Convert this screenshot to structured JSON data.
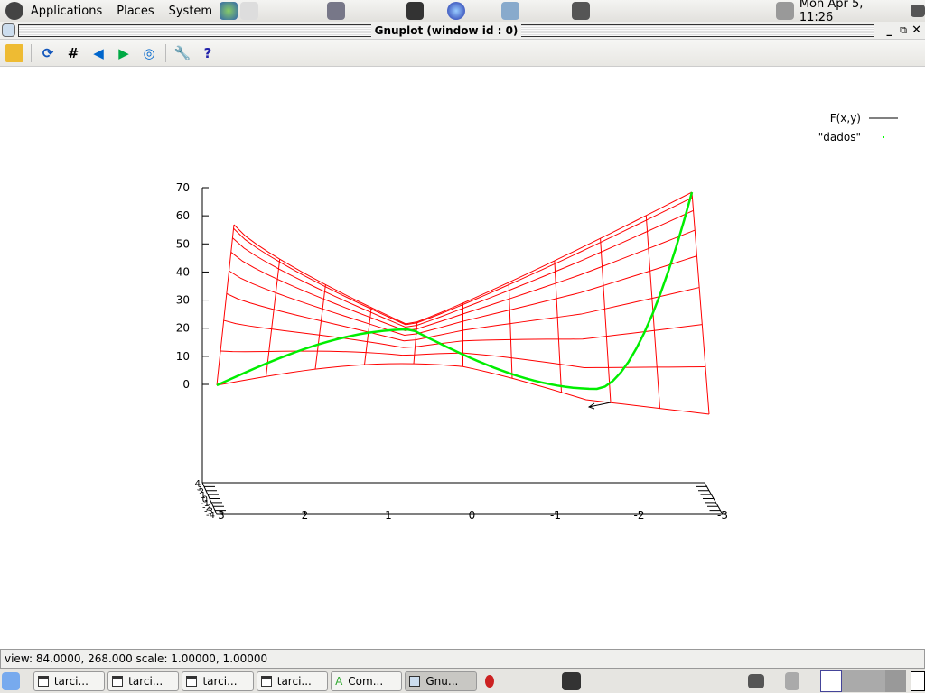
{
  "topbar": {
    "menus": [
      "Applications",
      "Places",
      "System"
    ],
    "clock": "Mon Apr  5, 11:26"
  },
  "window": {
    "title": "Gnuplot (window id : 0)"
  },
  "toolbar": {
    "icons": [
      "copy-clipboard-icon",
      "replot-icon",
      "grid-icon",
      "zoom-prev-icon",
      "zoom-next-icon",
      "autoscale-icon",
      "options-wrench-icon",
      "help-icon"
    ]
  },
  "chart_data": {
    "type": "surface3d",
    "legend": [
      {
        "name": "F(x,y)",
        "style": "line",
        "color": "#ff0000"
      },
      {
        "name": "\"dados\"",
        "style": "points",
        "color": "#00ff00"
      }
    ],
    "legend_position": "top-right",
    "zticks": [
      "70",
      "60",
      "50",
      "40",
      "30",
      "20",
      "10",
      "0"
    ],
    "xticks": [
      "3",
      "2",
      "1",
      "0",
      "-1",
      "-2",
      "-3"
    ],
    "yticks": [
      "4",
      "3",
      "2",
      "1",
      "0",
      "-1",
      "-2",
      "-3",
      "-4"
    ],
    "zlim": [
      0,
      70
    ]
  },
  "status": {
    "text": "view: 84.0000,  268.000   scale: 1.00000,  1.00000"
  },
  "taskbar": {
    "tasks": [
      "tarci...",
      "tarci...",
      "tarci...",
      "tarci...",
      "Com...",
      "Gnu..."
    ]
  }
}
